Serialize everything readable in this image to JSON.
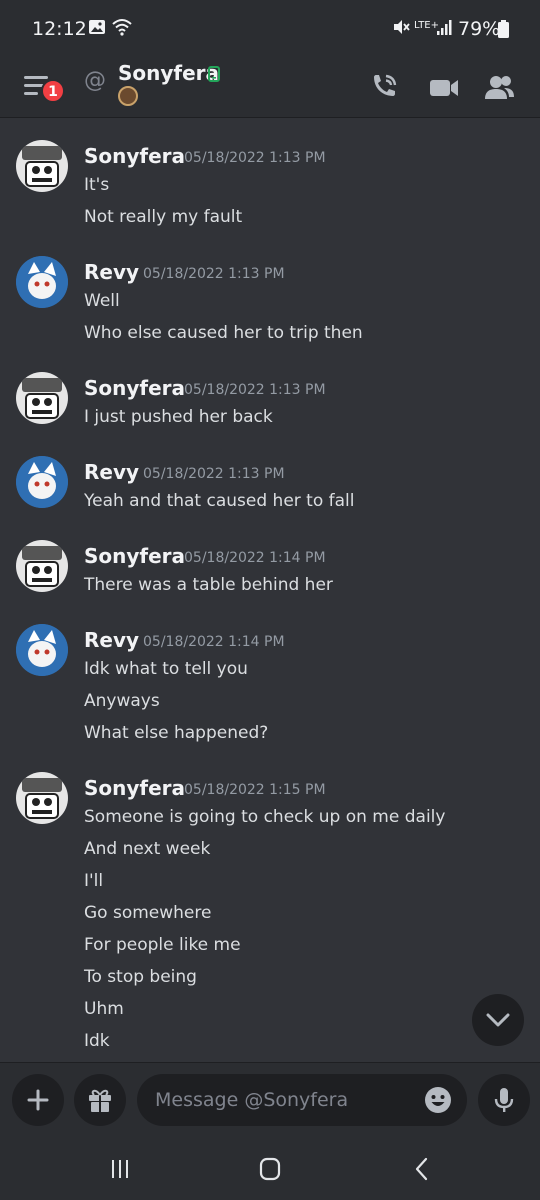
{
  "status_bar": {
    "time": "12:12",
    "network": "LTE+",
    "battery": "79%"
  },
  "header": {
    "badge_count": "1",
    "at_symbol": "@",
    "title": "Sonyfera"
  },
  "messages": [
    {
      "author": "Sonyfera",
      "timestamp": "05/18/2022 1:13 PM",
      "lines": [
        "It's",
        "Not really my fault"
      ]
    },
    {
      "author": "Revy",
      "timestamp": "05/18/2022 1:13 PM",
      "lines": [
        "Well",
        "Who else caused her to trip then"
      ]
    },
    {
      "author": "Sonyfera",
      "timestamp": "05/18/2022 1:13 PM",
      "lines": [
        "I just pushed her back"
      ]
    },
    {
      "author": "Revy",
      "timestamp": "05/18/2022 1:13 PM",
      "lines": [
        "Yeah and that caused her to fall"
      ]
    },
    {
      "author": "Sonyfera",
      "timestamp": "05/18/2022 1:14 PM",
      "lines": [
        "There was a table behind her"
      ]
    },
    {
      "author": "Revy",
      "timestamp": "05/18/2022 1:14 PM",
      "lines": [
        "Idk what to tell you",
        "Anyways",
        "What else happened?"
      ]
    },
    {
      "author": "Sonyfera",
      "timestamp": "05/18/2022 1:15 PM",
      "lines": [
        "Someone is going to check up on me daily",
        "And next week",
        "I'll",
        "Go somewhere",
        "For people like me",
        "To stop being",
        "Uhm",
        "Idk"
      ]
    }
  ],
  "composer": {
    "placeholder": "Message @Sonyfera"
  },
  "icons": {
    "menu": "hamburger-menu-icon",
    "call": "phone-call-icon",
    "video": "video-camera-icon",
    "members": "members-icon",
    "add": "plus-icon",
    "gift": "gift-icon",
    "emoji": "emoji-icon",
    "mic": "microphone-icon",
    "scroll": "chevron-down-icon"
  },
  "colors": {
    "background": "#313338",
    "header": "#2b2d31",
    "badge": "#f23f43",
    "online": "#23a55a"
  }
}
